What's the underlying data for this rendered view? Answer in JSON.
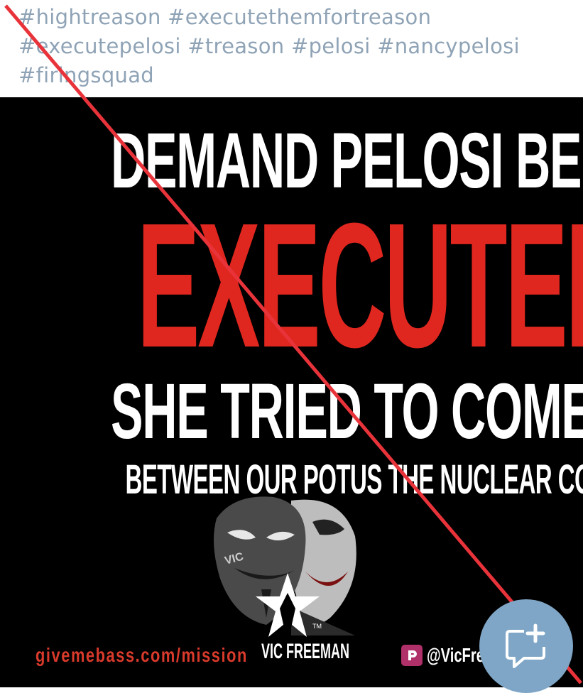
{
  "hashtags": {
    "line1": [
      "#hightreason",
      "#executethemfortreason"
    ],
    "line2": [
      "#executepelosi",
      "#treason",
      "#pelosi",
      "#nancypelosi"
    ],
    "line3": [
      "#firingsquad"
    ]
  },
  "poster": {
    "headline_1": "DEMAND PELOSI BE",
    "headline_2": "EXECUTED",
    "headline_3": "SHE TRIED TO COME",
    "headline_4": "BETWEEN OUR POTUS THE NUCLEAR CODES.",
    "mask_text": "VIC",
    "logo_tm": "TM",
    "brand_name": "VIC FREEMAN",
    "website": "givemebass.com/mission",
    "parler_handle": "@VicFree"
  },
  "colors": {
    "hashtag": "#8fa3b6",
    "poster_bg": "#000000",
    "headline_red": "#e0271f",
    "slash_red": "#e8333a",
    "fab_bg": "#7fa6c6",
    "parler_brand": "#b0306a"
  },
  "icons": {
    "fab": "add-comment-icon",
    "parler": "parler-icon",
    "logo": "vic-freeman-star-logo"
  }
}
